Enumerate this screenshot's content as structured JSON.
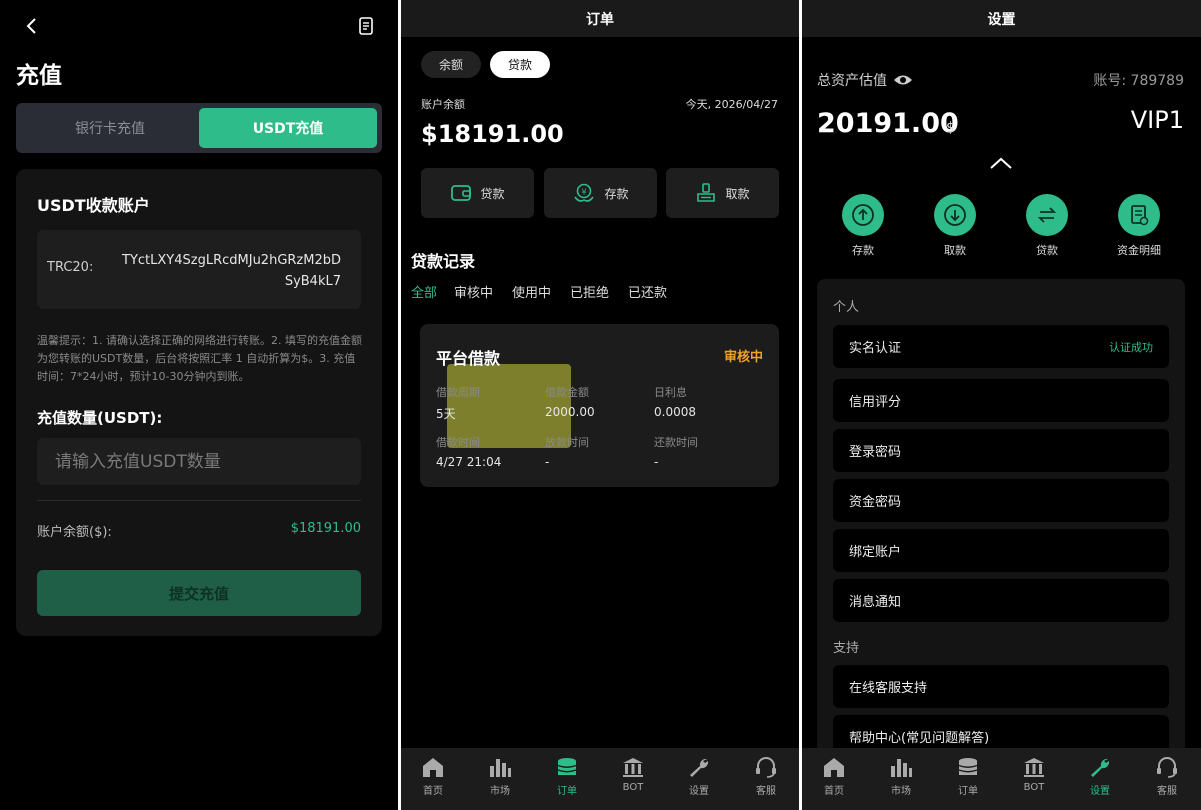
{
  "panel1": {
    "title": "充值",
    "tabs": [
      "银行卡充值",
      "USDT充值"
    ],
    "card_title": "USDT收款账户",
    "network": "TRC20:",
    "address": "TYctLXY4SzgLRcdMJu2hGRzM2bDSyB4kL7",
    "tip": "温馨提示：1. 请确认选择正确的网络进行转账。2. 填写的充值金额为您转账的USDT数量，后台将按照汇率 1 自动折算为$。3. 充值时间：7*24小时，预计10-30分钟内到账。",
    "qty_label": "充值数量(USDT):",
    "qty_placeholder": "请输入充值USDT数量",
    "balance_label": "账户余额($):",
    "balance_value": "$18191.00",
    "submit_label": "提交充值"
  },
  "panel2": {
    "header": "订单",
    "pills": [
      "余额",
      "贷款"
    ],
    "account_label": "账户余额",
    "date": "今天, 2026/04/27",
    "balance": "$18191.00",
    "actions": [
      "贷款",
      "存款",
      "取款"
    ],
    "section_title": "贷款记录",
    "filters": [
      "全部",
      "审核中",
      "使用中",
      "已拒绝",
      "已还款"
    ],
    "loan": {
      "title": "平台借款",
      "status": "审核中",
      "fields": [
        {
          "k": "借款周期",
          "v": "5天"
        },
        {
          "k": "借款金额",
          "v": "2000.00"
        },
        {
          "k": "日利息",
          "v": "0.0008"
        },
        {
          "k": "借款时间",
          "v": "4/27 21:04"
        },
        {
          "k": "放款时间",
          "v": "-"
        },
        {
          "k": "还款时间",
          "v": "-"
        }
      ]
    }
  },
  "panel3": {
    "header": "设置",
    "asset_label": "总资产估值",
    "account_no": "账号: 789789",
    "asset_value": "20191.00",
    "asset_currency": "$",
    "vip": "VIP1",
    "quick": [
      "存款",
      "取款",
      "贷款",
      "资金明细"
    ],
    "group_personal": "个人",
    "personal_items": [
      "实名认证",
      "信用评分",
      "登录密码",
      "资金密码",
      "绑定账户",
      "消息通知"
    ],
    "verified": "认证成功",
    "group_support": "支持",
    "support_items": [
      "在线客服支持",
      "帮助中心(常见问题解答)"
    ]
  },
  "nav": [
    "首页",
    "市场",
    "订单",
    "BOT",
    "设置",
    "客服"
  ],
  "colors": {
    "accent": "#2ebd8a",
    "warning": "#f0a12a",
    "panel": "#141414"
  }
}
